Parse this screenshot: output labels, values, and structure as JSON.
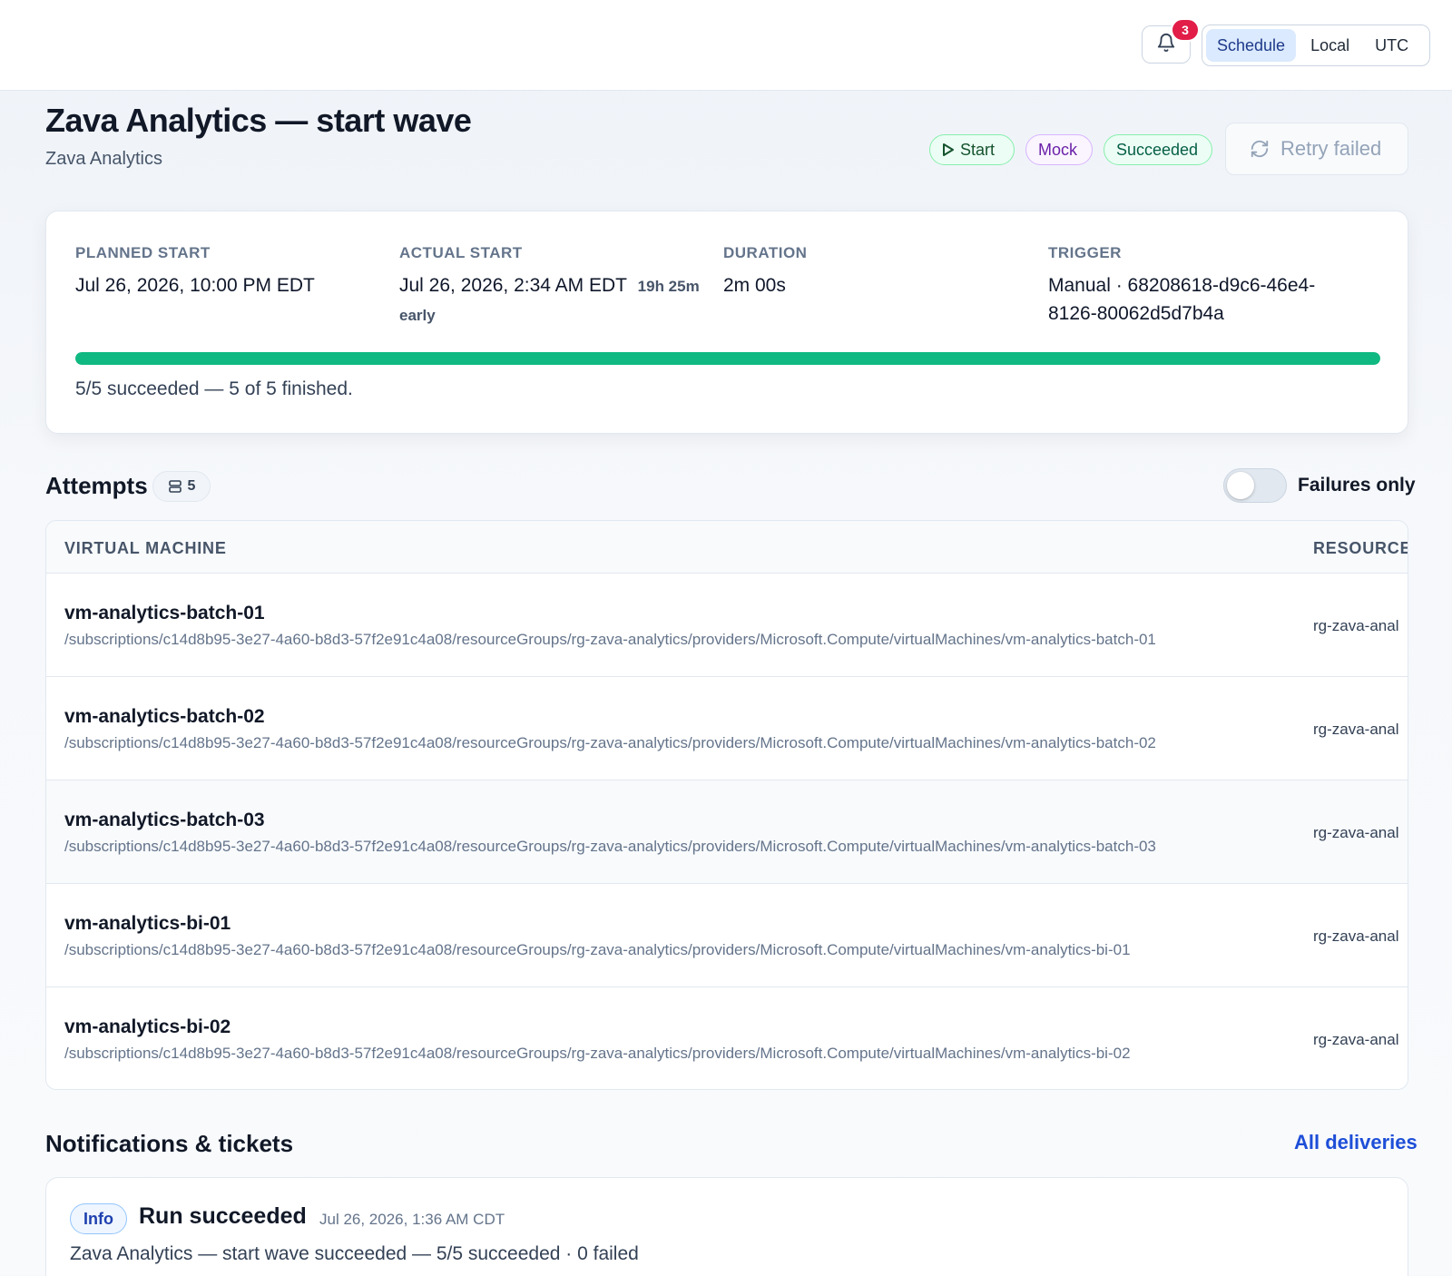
{
  "topbar": {
    "notification_count": "3",
    "timezones": [
      {
        "label": "Schedule",
        "active": true
      },
      {
        "label": "Local",
        "active": false
      },
      {
        "label": "UTC",
        "active": false
      }
    ]
  },
  "header": {
    "title": "Zava Analytics — start wave",
    "subtitle": "Zava Analytics",
    "chips": {
      "start": "Start",
      "mock": "Mock",
      "succeeded": "Succeeded"
    },
    "retry_label": "Retry failed"
  },
  "summary": {
    "planned_start_label": "Planned start",
    "planned_start_value": "Jul 26, 2026, 10:00 PM EDT",
    "actual_start_label": "Actual start",
    "actual_start_value": "Jul 26, 2026, 2:34 AM EDT",
    "actual_start_note_1": "19h 25m",
    "actual_start_note_2": "early",
    "duration_label": "Duration",
    "duration_value": "2m 00s",
    "trigger_label": "Trigger",
    "trigger_value": "Manual · 68208618-d9c6-46e4-8126-80062d5d7b4a",
    "progress_percent": 100,
    "progress_text": "5/5 succeeded — 5 of 5 finished."
  },
  "attempts": {
    "title": "Attempts",
    "count": "5",
    "failures_only_label": "Failures only",
    "failures_only": false,
    "columns": {
      "vm": "Virtual machine",
      "resource": "Resource"
    },
    "rows": [
      {
        "name": "vm-analytics-batch-01",
        "id": "/subscriptions/c14d8b95-3e27-4a60-b8d3-57f2e91c4a08/resourceGroups/rg-zava-analytics/providers/Microsoft.Compute/virtualMachines/vm-analytics-batch-01",
        "resource": "rg-zava-anal"
      },
      {
        "name": "vm-analytics-batch-02",
        "id": "/subscriptions/c14d8b95-3e27-4a60-b8d3-57f2e91c4a08/resourceGroups/rg-zava-analytics/providers/Microsoft.Compute/virtualMachines/vm-analytics-batch-02",
        "resource": "rg-zava-anal"
      },
      {
        "name": "vm-analytics-batch-03",
        "id": "/subscriptions/c14d8b95-3e27-4a60-b8d3-57f2e91c4a08/resourceGroups/rg-zava-analytics/providers/Microsoft.Compute/virtualMachines/vm-analytics-batch-03",
        "resource": "rg-zava-anal"
      },
      {
        "name": "vm-analytics-bi-01",
        "id": "/subscriptions/c14d8b95-3e27-4a60-b8d3-57f2e91c4a08/resourceGroups/rg-zava-analytics/providers/Microsoft.Compute/virtualMachines/vm-analytics-bi-01",
        "resource": "rg-zava-anal"
      },
      {
        "name": "vm-analytics-bi-02",
        "id": "/subscriptions/c14d8b95-3e27-4a60-b8d3-57f2e91c4a08/resourceGroups/rg-zava-analytics/providers/Microsoft.Compute/virtualMachines/vm-analytics-bi-02",
        "resource": "rg-zava-anal"
      }
    ]
  },
  "notifications": {
    "title": "Notifications & tickets",
    "all_deliveries_label": "All deliveries",
    "items": [
      {
        "severity": "Info",
        "heading": "Run succeeded",
        "time": "Jul 26, 2026, 1:36 AM CDT",
        "body": "Zava Analytics — start wave succeeded — 5/5 succeeded · 0 failed"
      }
    ]
  },
  "icons": {
    "bell": "bell-icon",
    "play": "play-icon",
    "retry": "refresh-icon",
    "stack": "server-stack-icon"
  },
  "colors": {
    "accent": "#1d4ed8",
    "success": "#10b981",
    "badge": "#e11d48",
    "mock": "#6b21a8"
  }
}
